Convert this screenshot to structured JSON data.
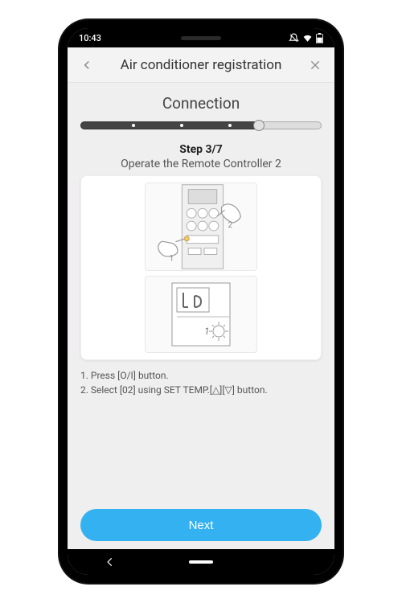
{
  "statusbar": {
    "time": "10:43"
  },
  "appbar": {
    "title": "Air conditioner registration"
  },
  "section": {
    "title": "Connection"
  },
  "progress": {
    "current": 3,
    "total": 7,
    "fillPercent": 74
  },
  "step": {
    "label": "Step 3/7",
    "subtitle": "Operate the Remote Controller 2"
  },
  "instructions": {
    "line1": "1. Press [O/I] button.",
    "line2": "2. Select [02] using SET TEMP.[△][▽] button."
  },
  "buttons": {
    "next": "Next"
  },
  "colors": {
    "accent": "#33b1f0",
    "text": "#444444",
    "muted": "#888888"
  }
}
